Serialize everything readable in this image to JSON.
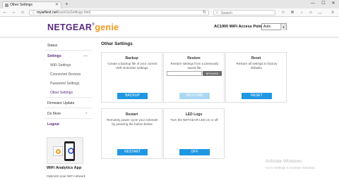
{
  "browser": {
    "tab_title": "Other Settings",
    "url_host": "mywifiext.net",
    "url_path": "/backUpSettings.html",
    "search_placeholder": "Search"
  },
  "header": {
    "logo_main": "NETGEAR",
    "logo_reg": "®",
    "logo_genie": "genie",
    "device_name": "AC1900 WiFi Access Point",
    "language_value": "Auto"
  },
  "sidebar": {
    "items": [
      {
        "label": "Status"
      },
      {
        "label": "Settings"
      },
      {
        "label": "WiFi Settings"
      },
      {
        "label": "Connected Devices"
      },
      {
        "label": "Password Settings"
      },
      {
        "label": "Other Settings"
      },
      {
        "label": "Firmware Update"
      },
      {
        "label": "Do More"
      },
      {
        "label": "Logout"
      }
    ],
    "promo_title": "WiFi Analytics App",
    "promo_text": "Optimize your WiFi network"
  },
  "main": {
    "title": "Other Settings",
    "cards": [
      {
        "title": "Backup",
        "desc": "Create a backup file of your current WiFi Extender settings.",
        "button": "BACKUP"
      },
      {
        "title": "Restore",
        "desc": "Restore settings from a previously saved file.",
        "browse": "BROWSE",
        "button": "RESTORE"
      },
      {
        "title": "Reset",
        "desc": "Restore all settings to factory defaults.",
        "button": "RESET"
      },
      {
        "title": "Restart",
        "desc": "Remotely power cycle your extender by pressing the button below.",
        "button": "RESTART"
      },
      {
        "title": "LED Logo",
        "desc": "Turn the NETGEAR LED on or off.",
        "button": "OFF"
      }
    ]
  },
  "watermark": {
    "line1": "Activate Windows",
    "line2": "Go to Settings to activate Windows."
  },
  "colors": {
    "brand_purple": "#5a2a82",
    "brand_orange": "#f0991d",
    "button_blue": "#1f97e2"
  }
}
